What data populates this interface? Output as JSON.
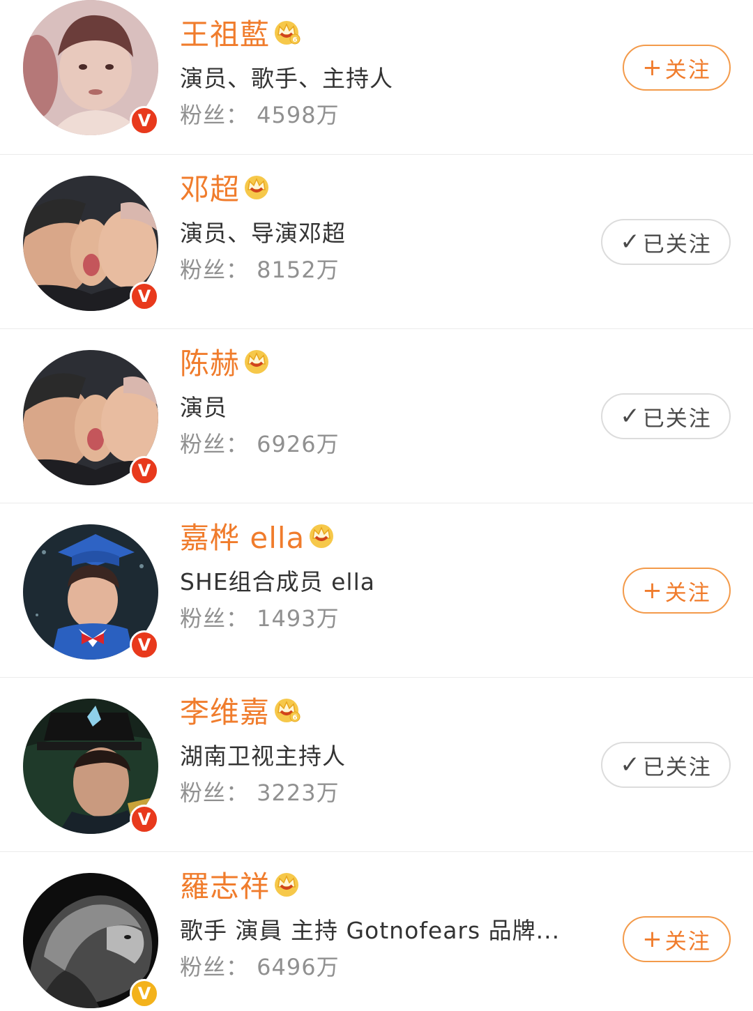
{
  "colors": {
    "name": "#f07c2c",
    "follow_border": "#f39a4a",
    "followed_border": "#dcdcdc",
    "badge_red": "#e8391c",
    "badge_gold": "#f3b21b"
  },
  "users": [
    {
      "name": "王祖藍",
      "crown_level": "6",
      "desc": "演员、歌手、主持人",
      "fans": "粉丝：  4598万",
      "button_label": "关注",
      "button_icon": "+",
      "followed": false,
      "badge_letter": "V",
      "badge_color": "red"
    },
    {
      "name": "邓超",
      "crown_level": "",
      "desc": "演员、导演邓超",
      "fans": "粉丝：  8152万",
      "button_label": "已关注",
      "button_icon": "✓",
      "followed": true,
      "badge_letter": "V",
      "badge_color": "red"
    },
    {
      "name": "陈赫",
      "crown_level": "",
      "desc": "演员",
      "fans": "粉丝：  6926万",
      "button_label": "已关注",
      "button_icon": "✓",
      "followed": true,
      "badge_letter": "V",
      "badge_color": "red"
    },
    {
      "name": "嘉桦 ella",
      "crown_level": "",
      "desc": "SHE组合成员 ella",
      "fans": "粉丝：  1493万",
      "button_label": "关注",
      "button_icon": "+",
      "followed": false,
      "badge_letter": "V",
      "badge_color": "red"
    },
    {
      "name": "李维嘉",
      "crown_level": "6",
      "desc": "湖南卫视主持人",
      "fans": "粉丝：  3223万",
      "button_label": "已关注",
      "button_icon": "✓",
      "followed": true,
      "badge_letter": "V",
      "badge_color": "red"
    },
    {
      "name": "羅志祥",
      "crown_level": "",
      "desc": "歌手 演員 主持 Gotnofears 品牌...",
      "fans": "粉丝：  6496万",
      "button_label": "关注",
      "button_icon": "+",
      "followed": false,
      "badge_letter": "V",
      "badge_color": "gold"
    }
  ]
}
